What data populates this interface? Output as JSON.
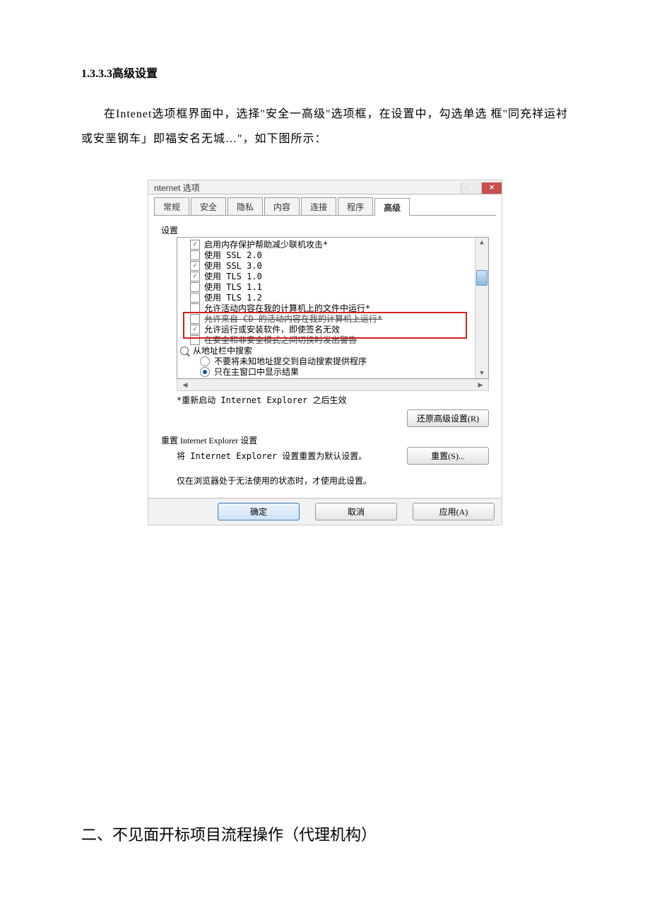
{
  "doc": {
    "section_number": "1.3.3.3",
    "section_title": "高级设置",
    "paragraph": "在Intenet选项框界面中，选择\"安全一高级\"选项框，在设置中，勾选单选 框\"同充祥运衬或安垩钢车」即福安名无城…\"，如下图所示：",
    "big_heading": "二、不见面开标项目流程操作（代理机构）"
  },
  "dialog": {
    "title": "nternet 选项",
    "tabs": [
      "常规",
      "安全",
      "隐私",
      "内容",
      "连接",
      "程序",
      "高级"
    ],
    "active_tab": "高级",
    "settings_label": "设置",
    "items": {
      "it0": "启用内存保护帮助减少联机攻击*",
      "it1": "使用 SSL 2.0",
      "it2": "使用 SSL 3.0",
      "it3": "使用 TLS 1.0",
      "it4": "使用 TLS 1.1",
      "it5": "使用 TLS 1.2",
      "it6": "允许活动内容在我的计算机上的文件中运行*",
      "it7": "允许来自 CD 的活动内容在我的计算机上运行*",
      "it8": "允许运行或安装软件，即使签名无效",
      "it9": "在安全和非安全模式之间切换时发出警告",
      "grp": "从地址栏中搜索",
      "rad1": "不要将未知地址提交到自动搜索提供程序",
      "rad2": "只在主窗口中显示结果"
    },
    "restart_note": "*重新启动 Internet Explorer 之后生效",
    "restore_btn": "还原高级设置(R)",
    "reset_label": "重置 Internet Explorer 设置",
    "reset_desc": "将 Internet Explorer 设置重置为默认设置。",
    "reset_btn": "重置(S)...",
    "reset_note": "仅在浏览器处于无法使用的状态时，才使用此设置。",
    "ok": "确定",
    "cancel": "取消",
    "apply": "应用(A)"
  }
}
